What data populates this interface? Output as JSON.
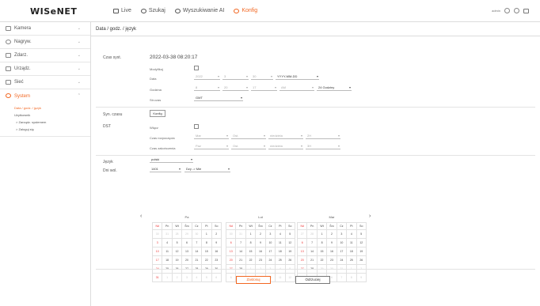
{
  "app": {
    "logo": "WISeNET"
  },
  "topnav": [
    {
      "label": "Live",
      "icon": "monitor-icon",
      "active": false
    },
    {
      "label": "Szukaj",
      "icon": "search-icon",
      "active": false
    },
    {
      "label": "Wyszukiwanie AI",
      "icon": "ai-search-icon",
      "active": false
    },
    {
      "label": "Konfig",
      "icon": "gear-icon",
      "active": true
    }
  ],
  "topright": {
    "user": "admin"
  },
  "sidebar": {
    "items": [
      {
        "label": "Kamera",
        "icon": "camera-icon"
      },
      {
        "label": "Nagryw.",
        "icon": "record-icon"
      },
      {
        "label": "Zdarz.",
        "icon": "event-icon"
      },
      {
        "label": "Urządz.",
        "icon": "device-icon"
      },
      {
        "label": "Sieć",
        "icon": "network-icon"
      },
      {
        "label": "System",
        "icon": "system-icon"
      }
    ],
    "sub": [
      {
        "label": "Data / godz. / język"
      },
      {
        "label": "Użytkownik"
      },
      {
        "label": "> Zarządz. systemem"
      },
      {
        "label": "> Zaloguj się"
      }
    ]
  },
  "page": {
    "breadcrumb": "Data / godz. / język"
  },
  "form": {
    "czas_label": "Czas syst.",
    "czas_value": "2022-03-38 08:20:17",
    "modyfikuj": "Modyfikuj",
    "data_label": "Data",
    "data_fields": [
      "2022",
      "3",
      "30",
      "YYYY-MM-DD"
    ],
    "godzina_label": "Godzina",
    "godzina_fields": [
      "8",
      "20",
      "17",
      "AM",
      "24 Godziny"
    ],
    "strefa_label": "Str.czas",
    "strefa_value": "GMT",
    "sync_label": "Syn. czasu",
    "sync_button": "Konfig",
    "dst_label": "DST",
    "wlacz": "Włącz",
    "start_label": "Czas rozpoczęcia",
    "end_label": "Czas zakończenia",
    "start_fields": [
      "Mar",
      "Ost.",
      "niedziela",
      "2H"
    ],
    "end_fields": [
      "Paź",
      "Ost.",
      "niedziela",
      "3H"
    ],
    "jezyk_label": "Język",
    "jezyk_value": "polski",
    "dni_label": "Dni wol.",
    "dni_fields": [
      "1401",
      "Dzy -> Mie"
    ]
  },
  "calendar": {
    "weekdays": [
      "Nd",
      "Pn",
      "Wt",
      "Śro",
      "Cz",
      "Pt",
      "So"
    ],
    "months": [
      {
        "name": "Pa",
        "rows": [
          [
            "30",
            "31",
            "28",
            "29",
            "30",
            "1",
            "2"
          ],
          [
            "3",
            "4",
            "5",
            "6",
            "7",
            "8",
            "9"
          ],
          [
            "10",
            "11",
            "12",
            "13",
            "14",
            "15",
            "16"
          ],
          [
            "17",
            "18",
            "19",
            "20",
            "21",
            "22",
            "23"
          ],
          [
            "24",
            "25",
            "26",
            "27",
            "28",
            "29",
            "30"
          ],
          [
            "31",
            "1",
            "2",
            "3",
            "4",
            "5",
            "6"
          ]
        ],
        "dim_first": 5,
        "dim_last": 6
      },
      {
        "name": "Lut",
        "rows": [
          [
            "30",
            "31",
            "1",
            "2",
            "3",
            "4",
            "5"
          ],
          [
            "6",
            "7",
            "8",
            "9",
            "10",
            "11",
            "12"
          ],
          [
            "13",
            "14",
            "15",
            "16",
            "17",
            "18",
            "19"
          ],
          [
            "20",
            "21",
            "22",
            "23",
            "24",
            "25",
            "26"
          ],
          [
            "27",
            "28",
            "1",
            "2",
            "3",
            "4",
            "5"
          ],
          [
            "6",
            "7",
            "8",
            "9",
            "10",
            "11",
            "12"
          ]
        ],
        "dim_first": 2,
        "dim_last": 12
      },
      {
        "name": "Mar",
        "rows": [
          [
            "27",
            "28",
            "1",
            "2",
            "3",
            "4",
            "5"
          ],
          [
            "6",
            "7",
            "8",
            "9",
            "10",
            "11",
            "12"
          ],
          [
            "13",
            "14",
            "15",
            "16",
            "17",
            "18",
            "19"
          ],
          [
            "20",
            "21",
            "22",
            "23",
            "24",
            "25",
            "26"
          ],
          [
            "27",
            "28",
            "29",
            "30",
            "31",
            "1",
            "2"
          ],
          [
            "3",
            "4",
            "5",
            "6",
            "7",
            "8",
            "9"
          ]
        ],
        "dim_first": 2,
        "dim_last": 12
      }
    ]
  },
  "footer": {
    "apply": "Zastosuj",
    "cancel": "Odrzuciej"
  },
  "colors": {
    "accent": "#f26722",
    "sunday": "#ee3333"
  }
}
